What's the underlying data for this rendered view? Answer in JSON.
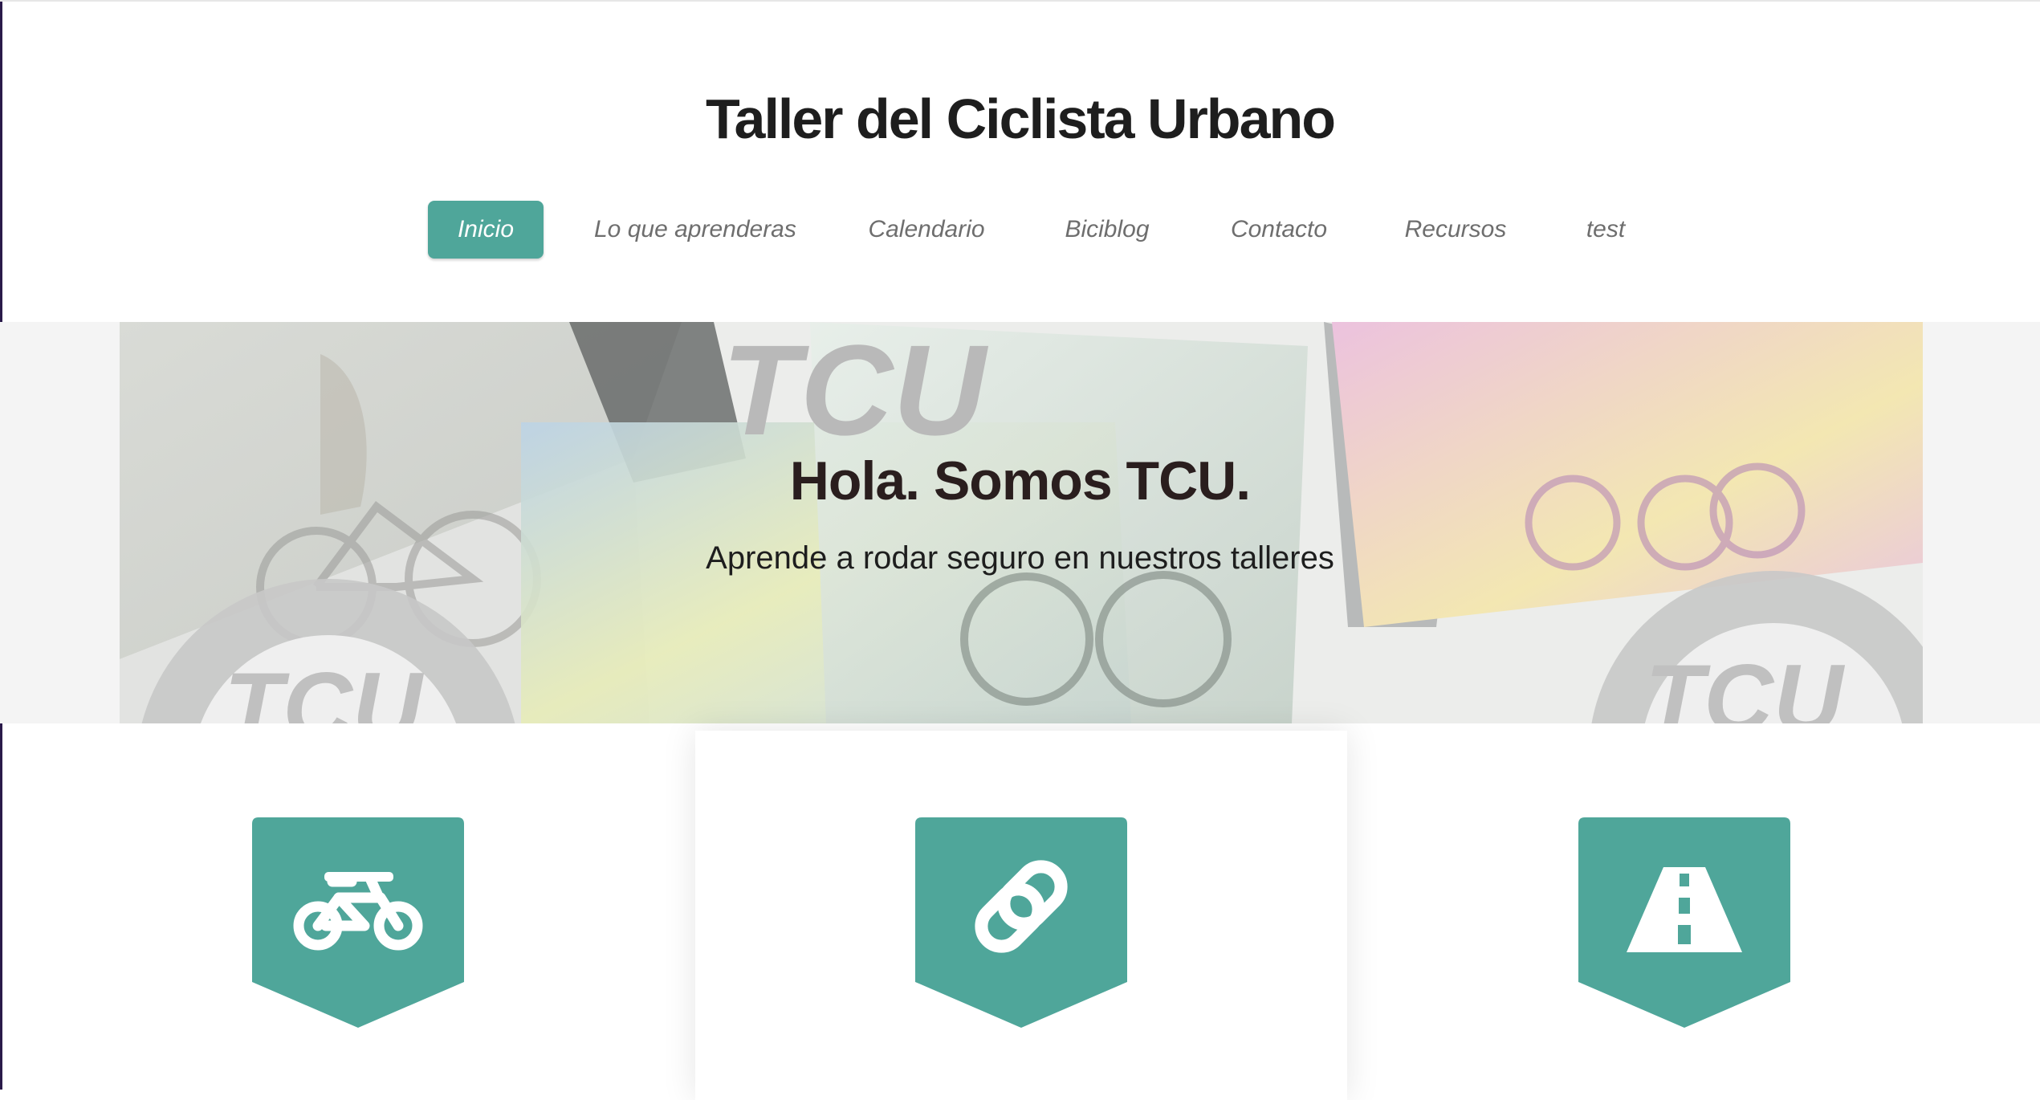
{
  "site": {
    "title": "Taller del Ciclista Urbano"
  },
  "nav": {
    "items": [
      {
        "label": "Inicio",
        "active": true
      },
      {
        "label": "Lo que aprenderas",
        "active": false
      },
      {
        "label": "Calendario",
        "active": false
      },
      {
        "label": "Biciblog",
        "active": false
      },
      {
        "label": "Contacto",
        "active": false
      },
      {
        "label": "Recursos",
        "active": false
      },
      {
        "label": "test",
        "active": false
      }
    ]
  },
  "hero": {
    "heading": "Hola. Somos TCU.",
    "subheading": "Aprende a rodar seguro en nuestros talleres",
    "image_text": "TCU"
  },
  "features": [
    {
      "icon": "bicycle-icon"
    },
    {
      "icon": "link-icon"
    },
    {
      "icon": "road-icon"
    }
  ],
  "colors": {
    "accent": "#4fa69a",
    "title": "#1e1e1e",
    "nav_text": "#6e6e6e",
    "hero_heading": "#2a1e1e"
  }
}
